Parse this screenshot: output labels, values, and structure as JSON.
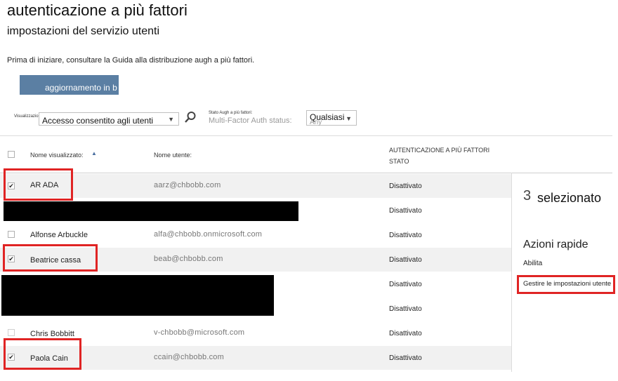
{
  "page": {
    "title": "autenticazione a più fattori",
    "subtitle": "impostazioni del servizio utenti",
    "intro": "Prima di iniziare, consultare la Guida alla distribuzione augh a più fattori."
  },
  "toolbar": {
    "update_button": "aggiornamento in b"
  },
  "filters": {
    "view_label": "Visualizzazione",
    "view_value": "Accesso consentito agli utenti",
    "mfa_label": "Stato Augh a più fattori:",
    "mfa_ghost": "Multi-Factor Auth status:",
    "mfa_ghost_value": "Any",
    "mfa_value": "Qualsiasi"
  },
  "table": {
    "headers": {
      "display_name": "Nome visualizzato:",
      "user_name": "Nome utente:",
      "mfa_line1": "AUTENTICAZIONE A PIÙ FATTORI",
      "mfa_line2": "STATO"
    },
    "rows": [
      {
        "name": "AR ADA",
        "user": "aarz@chbobb.com",
        "status": "Disattivato",
        "checked": true
      },
      {
        "name": "",
        "user": "",
        "status": "Disattivato",
        "checked": false
      },
      {
        "name": "Alfonse Arbuckle",
        "user": "alfa@chbobb.onmicrosoft.com",
        "status": "Disattivato",
        "checked": false
      },
      {
        "name": "Beatrice cassa",
        "user": "beab@chbobb.com",
        "status": "Disattivato",
        "checked": true
      },
      {
        "name": "",
        "user": "",
        "status": "Disattivato",
        "checked": false
      },
      {
        "name": "",
        "user": "",
        "status": "Disattivato",
        "checked": false
      },
      {
        "name": "Chris Bobbitt",
        "user": "v-chbobb@microsoft.com",
        "status": "Disattivato",
        "checked": false
      },
      {
        "name": "Paola Cain",
        "user": "ccain@chbobb.com",
        "status": "Disattivato",
        "checked": true
      }
    ]
  },
  "panel": {
    "selected_count": "3",
    "selected_label": "selezionato",
    "quick_actions": "Azioni rapide",
    "enable": "Abilita",
    "manage": "Gestire le impostazioni utente"
  },
  "icons": {
    "search": "search-icon",
    "sort": "sort-ascending-icon",
    "caret": "chevron-down-icon",
    "check": "checkmark-icon"
  },
  "colors": {
    "accent": "#5b7fa3",
    "highlight": "#e02424",
    "row_alt": "#f1f1f1"
  }
}
